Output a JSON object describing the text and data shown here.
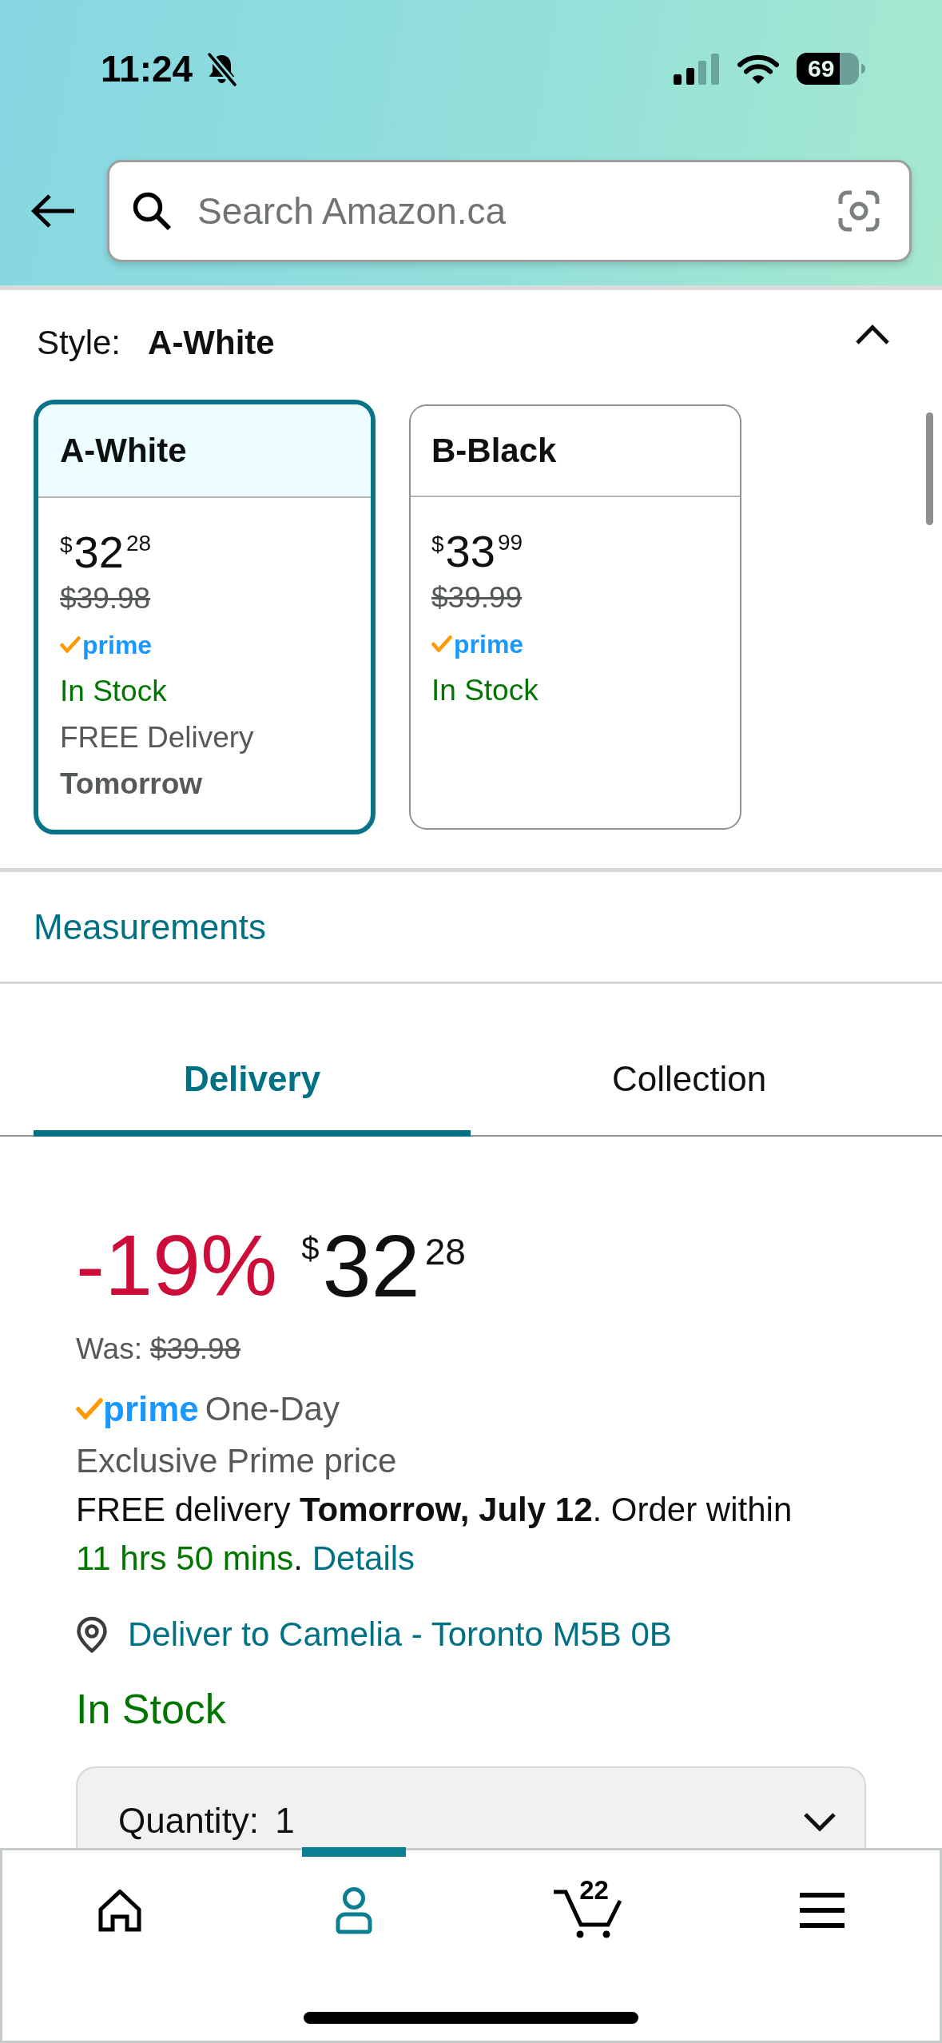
{
  "status_bar": {
    "time": "11:24",
    "battery": "69"
  },
  "search": {
    "placeholder": "Search Amazon.ca"
  },
  "style_selector": {
    "label": "Style:",
    "value": "A-White",
    "expanded": true,
    "options": [
      {
        "name": "A-White",
        "selected": true,
        "price_symbol": "$",
        "price_whole": "32",
        "price_fraction": "28",
        "list_price": "$39.98",
        "prime_badge": "prime",
        "stock": "In Stock",
        "delivery": "FREE Delivery",
        "delivery_day": "Tomorrow"
      },
      {
        "name": "B-Black",
        "selected": false,
        "price_symbol": "$",
        "price_whole": "33",
        "price_fraction": "99",
        "list_price": "$39.99",
        "prime_badge": "prime",
        "stock": "In Stock"
      }
    ]
  },
  "measurements_link": "Measurements",
  "tabs": [
    {
      "label": "Delivery",
      "selected": true
    },
    {
      "label": "Collection",
      "selected": false
    }
  ],
  "offer": {
    "discount": "-19%",
    "price_symbol": "$",
    "price_whole": "32",
    "price_fraction": "28",
    "was_label": "Was:",
    "was_price": "$39.98",
    "prime_badge": "prime",
    "prime_program": "One-Day",
    "prime_note": "Exclusive Prime price",
    "delivery": "FREE delivery **Tomorrow, July 12**. Order within",
    "countdown": "11 hrs 50 mins",
    "countdown_end": ".",
    "details_link": "Details",
    "deliver_to": "Deliver to Camelia - Toronto M5B 0B",
    "stock": "In Stock",
    "quantity": {
      "label": "Quantity:",
      "value": "1"
    }
  },
  "bottom_nav": [
    {
      "kind": "home",
      "selected": false
    },
    {
      "kind": "account",
      "selected": true
    },
    {
      "kind": "cart",
      "selected": false,
      "count": "22"
    },
    {
      "kind": "menu",
      "selected": false
    }
  ]
}
